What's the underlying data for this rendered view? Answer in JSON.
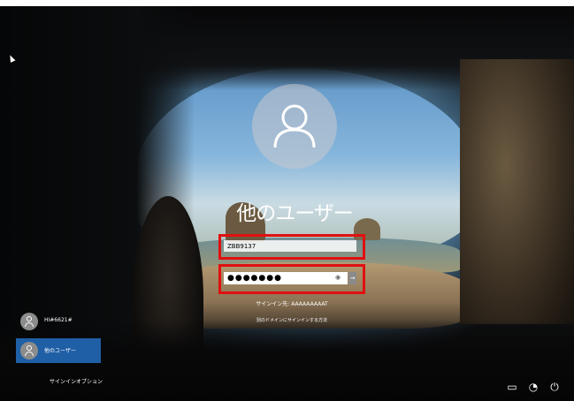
{
  "login": {
    "username": "他のユーザー",
    "user_field_value": "ZBB9137",
    "password_mask": "●●●●●●●",
    "reveal_icon": "eye-icon",
    "submit_icon": "arrow-right-icon",
    "hint_line1": "サインイン先: AAAAAAAAAT",
    "hint_line2": "別のドメインにサインインする方法"
  },
  "users": [
    {
      "label": "HI#6621#",
      "icon": "user-icon"
    },
    {
      "label": "他のユーザー",
      "icon": "user-icon",
      "selected": true
    }
  ],
  "signin_options": "サインインオプション",
  "tray": {
    "network_icon": "network-icon",
    "accessibility_icon": "ease-of-access-icon",
    "power_icon": "power-icon"
  }
}
